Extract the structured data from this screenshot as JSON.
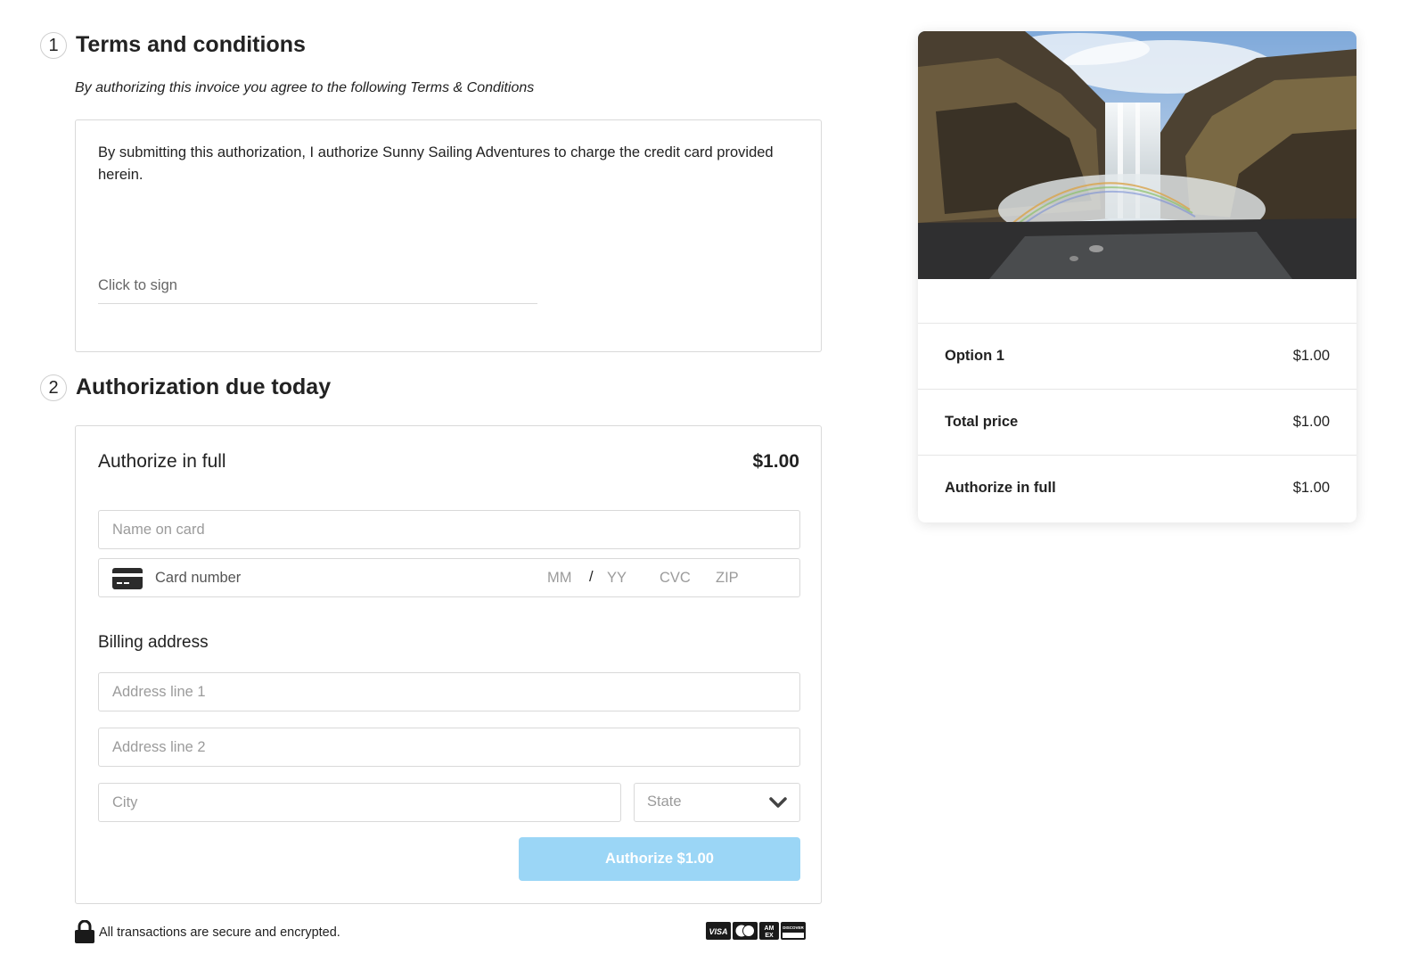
{
  "terms": {
    "step": "1",
    "title": "Terms and conditions",
    "subtitle": "By authorizing this invoice you agree to the following Terms & Conditions",
    "body": "By submitting this authorization, I authorize Sunny Sailing Adventures to charge the credit card provided herein.",
    "sign_label": "Click to sign"
  },
  "authorization": {
    "step": "2",
    "title": "Authorization due today",
    "label": "Authorize in full",
    "amount": "$1.00",
    "name_placeholder": "Name on card",
    "card_placeholder": "Card number",
    "mm_placeholder": "MM",
    "slash": "/",
    "yy_placeholder": "YY",
    "cvc_placeholder": "CVC",
    "zip_placeholder": "ZIP",
    "billing_label": "Billing address",
    "address1_placeholder": "Address line 1",
    "address2_placeholder": "Address line 2",
    "city_placeholder": "City",
    "state_label": "State",
    "button_label": "Authorize $1.00"
  },
  "footer": {
    "secure_text": "All transactions are secure and encrypted.",
    "card_brands": [
      "VISA",
      "Mastercard",
      "AMEX",
      "DISCOVER"
    ]
  },
  "summary": {
    "rows": [
      {
        "label": "Option 1",
        "value": "$1.00"
      },
      {
        "label": "Total price",
        "value": "$1.00"
      },
      {
        "label": "Authorize in full",
        "value": "$1.00"
      }
    ]
  },
  "colors": {
    "button_bg": "#9bd6f6",
    "border": "#d9d9d9",
    "text": "#222222"
  }
}
